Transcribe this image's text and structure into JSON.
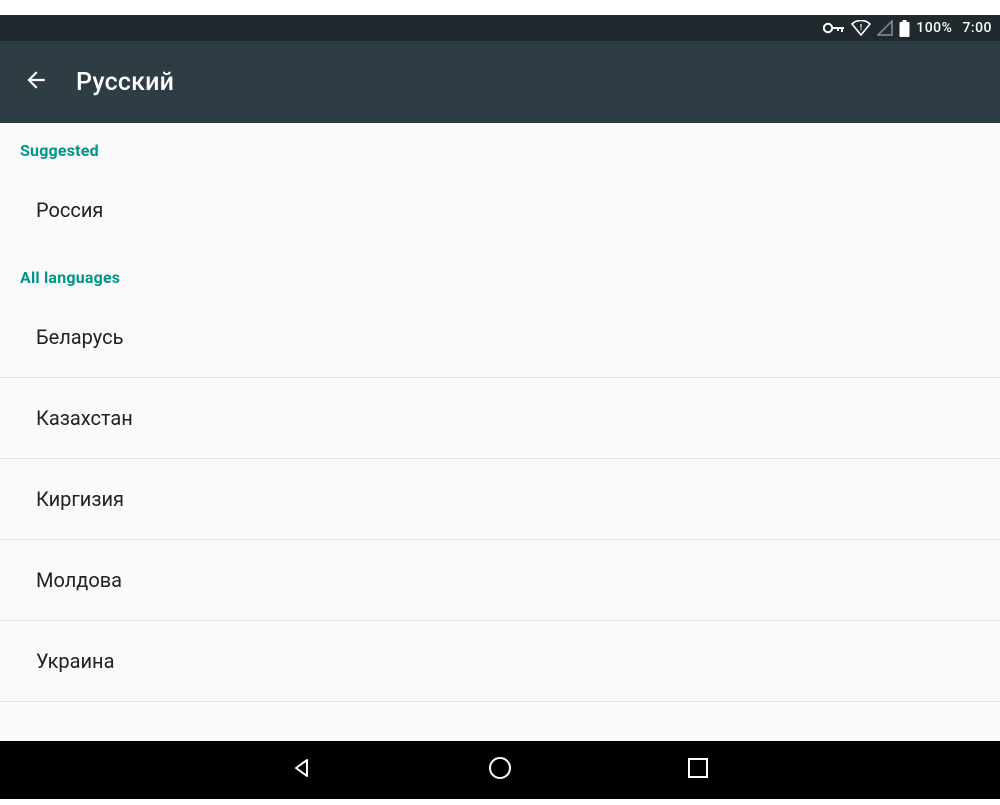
{
  "status": {
    "battery_percent": "100%",
    "time": "7:00"
  },
  "appbar": {
    "title": "Русский"
  },
  "sections": {
    "suggested_label": "Suggested",
    "all_label": "All languages"
  },
  "suggested": [
    {
      "label": "Россия"
    }
  ],
  "all": [
    {
      "label": "Беларусь"
    },
    {
      "label": "Казахстан"
    },
    {
      "label": "Киргизия"
    },
    {
      "label": "Молдова"
    },
    {
      "label": "Украина"
    }
  ]
}
